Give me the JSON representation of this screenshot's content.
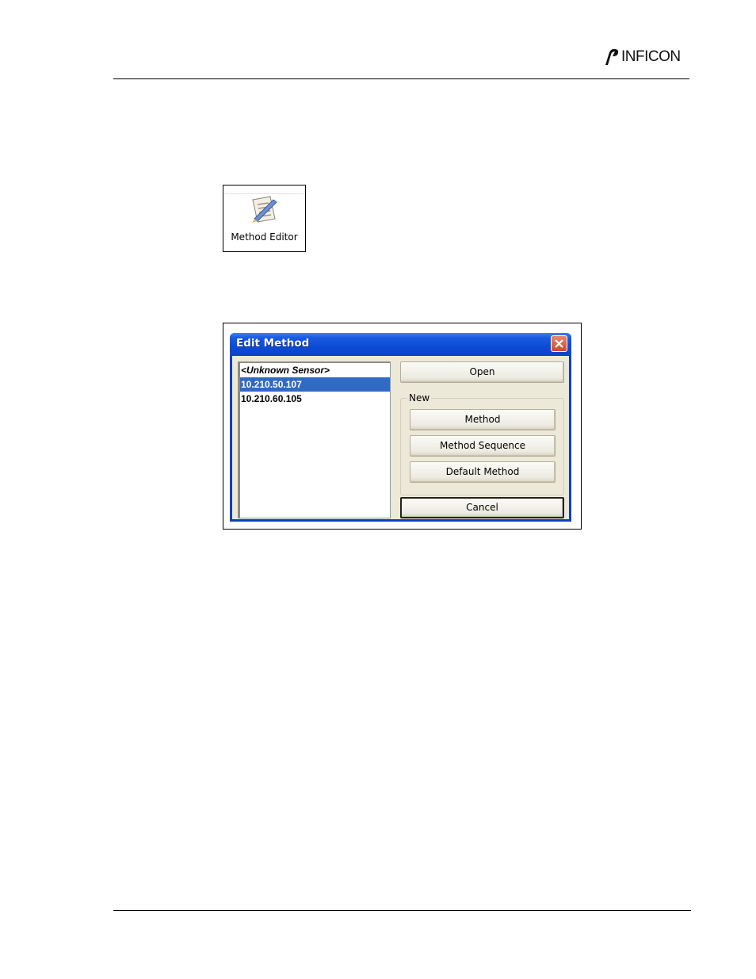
{
  "header": {
    "brand_name": "INFICON"
  },
  "launcher": {
    "label": "Method Editor",
    "icon": "method-editor-icon"
  },
  "dialog": {
    "title": "Edit Method",
    "close_icon": "close-icon",
    "list": [
      {
        "label": "<Unknown Sensor>",
        "selected": false
      },
      {
        "label": "10.210.50.107",
        "selected": true
      },
      {
        "label": "10.210.60.105",
        "selected": false
      }
    ],
    "open_label": "Open",
    "new_group_label": "New",
    "method_label": "Method",
    "method_sequence_label": "Method Sequence",
    "default_method_label": "Default Method",
    "cancel_label": "Cancel"
  },
  "colors": {
    "titlebar": "#0a43c9",
    "selection": "#316ac5",
    "dialog_face": "#ece9d8",
    "close_button": "#d4472a"
  }
}
